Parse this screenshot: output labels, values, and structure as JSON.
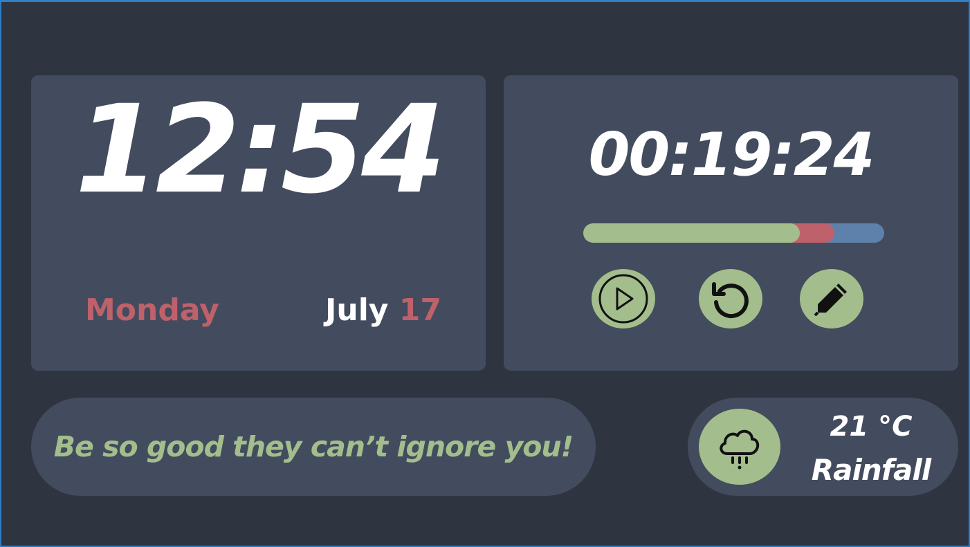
{
  "clock": {
    "time": "12:54",
    "day": "Monday",
    "month": "July",
    "date": "17"
  },
  "timer": {
    "time": "00:19:24",
    "progress": {
      "green_fraction": 0.72,
      "red_fraction": 0.835
    },
    "buttons": {
      "play": "play-icon",
      "reset": "reset-icon",
      "edit": "pencil-icon"
    }
  },
  "quote": {
    "text": "Be so good they can’t ignore you!"
  },
  "weather": {
    "temperature": "21 °C",
    "condition": "Rainfall",
    "icon": "rain-cloud-icon"
  },
  "colors": {
    "background": "#2e3440",
    "card": "#434c5e",
    "accent_green": "#a3be8c",
    "accent_red": "#bf616a",
    "accent_blue": "#5e81ac",
    "text": "#ffffff"
  }
}
